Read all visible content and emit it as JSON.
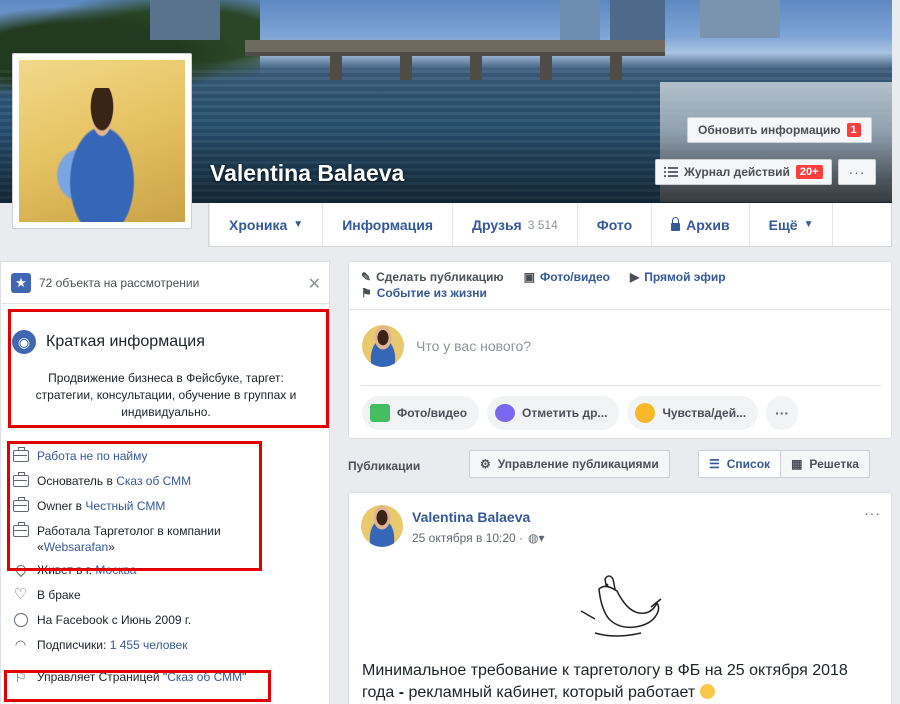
{
  "profile": {
    "name": "Valentina Balaeva",
    "update_info_label": "Обновить информацию",
    "update_info_badge": "1",
    "activity_log_label": "Журнал действий",
    "activity_log_badge": "20+",
    "more_dots": "···"
  },
  "nav": {
    "timeline": "Хроника",
    "about": "Информация",
    "friends": "Друзья",
    "friends_count": "3 514",
    "photos": "Фото",
    "archive": "Архив",
    "more": "Ещё"
  },
  "sidebar": {
    "review_text": "72 объекта на рассмотрении",
    "intro_title": "Краткая информация",
    "intro_description": "Продвижение бизнеса в Фейсбуке, таргет: стратегии, консультации, обучение в группах и индивидуально.",
    "info": {
      "freelance": "Работа не по найму",
      "founder_prefix": "Основатель в ",
      "founder_link": "Сказ об СММ",
      "owner_prefix": "Owner в ",
      "owner_link": "Честный СММ",
      "worked_prefix": "Работала Таргетолог в компании «",
      "worked_link": "Websarafan",
      "worked_suffix": "»",
      "lives_prefix": "Живет в г. ",
      "lives_link": "Москва",
      "relationship": "В браке",
      "joined": "На Facebook с Июнь 2009 г.",
      "followers_prefix": "Подписчики: ",
      "followers_link": "1 455 человек",
      "manages_prefix": "Управляет Страницей \"",
      "manages_link": "Сказ об СММ",
      "manages_suffix": "\""
    }
  },
  "composer": {
    "create_post": "Сделать публикацию",
    "photo_video": "Фото/видео",
    "live": "Прямой эфир",
    "life_event": "Событие из жизни",
    "placeholder": "Что у вас нового?",
    "pill_photo": "Фото/видео",
    "pill_tag": "Отметить др...",
    "pill_feeling": "Чувства/дей...",
    "pill_more": "···"
  },
  "posts_bar": {
    "label": "Публикации",
    "manage": "Управление публикациями",
    "list": "Список",
    "grid": "Решетка"
  },
  "post": {
    "author": "Valentina Balaeva",
    "time": "25 октября в 10:20 ·",
    "text_normal": "Минимальное требование к таргетологу в ФБ на 25 октября 2018 года ",
    "text_bold": "-",
    "text_after": " рекламный кабинет, который работает ",
    "dots": "···"
  },
  "colors": {
    "link": "#365899",
    "highlight_box": "#e00000",
    "badge": "#fa3e3e"
  }
}
